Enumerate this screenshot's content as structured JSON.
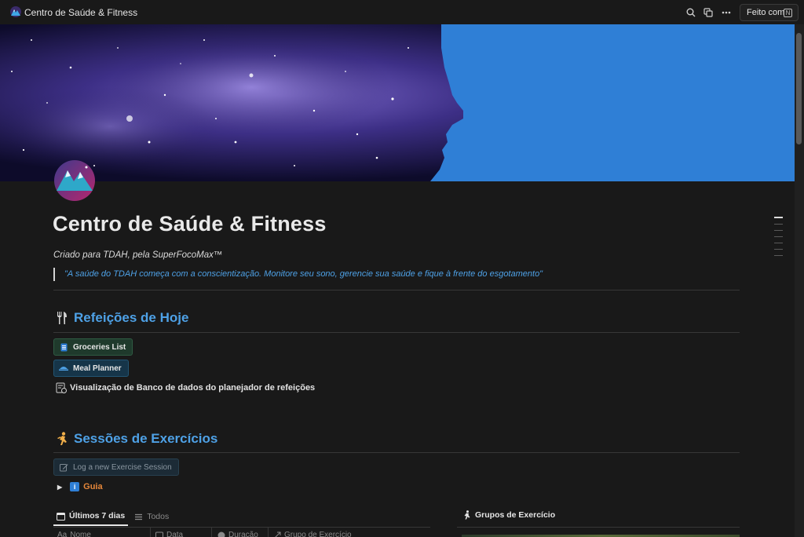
{
  "window": {
    "title": "Centro de Saúde & Fitness",
    "done_button": "Feito com",
    "icons": [
      "logo-icon",
      "search-icon",
      "duplicate-icon",
      "more-icon",
      "notion-icon"
    ]
  },
  "page": {
    "title": "Centro de Saúde & Fitness",
    "subtitle": "Criado para TDAH, pela SuperFocoMax™",
    "quote": "\"A saúde do TDAH começa com a conscientização. Monitore seu sono, gerencie sua saúde e fique à frente do esgotamento\""
  },
  "meals": {
    "heading": "Refeições de Hoje",
    "heading_icon": "fork-knife-icon",
    "buttons": [
      {
        "label": "Groceries List",
        "icon": "list-icon"
      },
      {
        "label": "Meal Planner",
        "icon": "dish-icon"
      }
    ],
    "db_view": "Visualização de Banco de dados do planejador de refeições"
  },
  "exercise": {
    "heading": "Sessões de Exercícios",
    "heading_icon": "runner-icon",
    "log_button": "Log a new Exercise Session",
    "toggle_label": "Guia",
    "tabs": [
      {
        "label": "Últimos 7 dias",
        "icon": "calendar-icon",
        "active": true
      },
      {
        "label": "Todos",
        "icon": "list-icon",
        "active": false
      }
    ],
    "columns": [
      {
        "label": "Nome",
        "icon": "Aa"
      },
      {
        "label": "Data",
        "icon": "calendar-icon"
      },
      {
        "label": "Duração",
        "icon": "clock-icon"
      },
      {
        "label": "Grupo de Exercício",
        "icon": "relation-icon"
      }
    ],
    "groups_heading": "Grupos de Exercício"
  },
  "colors": {
    "background": "#191919",
    "accent_blue": "#4ea1e6",
    "orange": "#e5873a",
    "cover_blue": "#2f7fd6"
  }
}
